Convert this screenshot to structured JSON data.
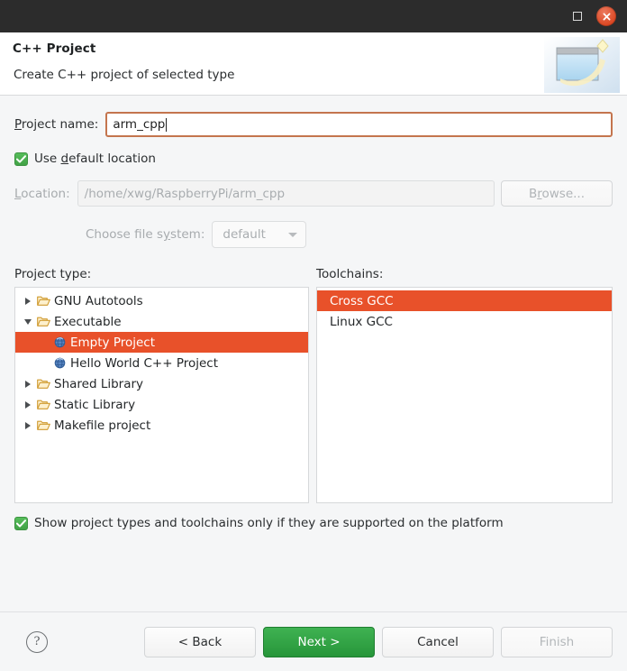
{
  "titlebar": {
    "maximize_label": "Maximize",
    "close_label": "Close"
  },
  "header": {
    "title": "C++ Project",
    "subtitle": "Create C++ project of selected type",
    "icon": "new-project-wizard-icon"
  },
  "form": {
    "project_name_label": "Project name:",
    "project_name_label_pre": "P",
    "project_name_label_post": "roject name:",
    "project_name_value": "arm_cpp",
    "use_default_location_label_pre": "Use ",
    "use_default_location_label_mid": "d",
    "use_default_location_label_post": "efault location",
    "use_default_location_checked": true,
    "location_label_pre": "L",
    "location_label_post": "ocation:",
    "location_value": "/home/xwg/RaspberryPi/arm_cpp",
    "location_disabled": true,
    "browse_label_pre": "B",
    "browse_label_mid": "r",
    "browse_label_post": "owse...",
    "browse_disabled": true,
    "filesystem_label_pre": "Choose file s",
    "filesystem_label_mid": "y",
    "filesystem_label_post": "stem:",
    "filesystem_value": "default",
    "filesystem_disabled": true
  },
  "project_type": {
    "label": "Project type:",
    "items": [
      {
        "label": "GNU Autotools",
        "depth": 0,
        "icon": "folder-icon",
        "twisty": "collapsed",
        "selected": false
      },
      {
        "label": "Executable",
        "depth": 0,
        "icon": "folder-icon",
        "twisty": "expanded",
        "selected": false
      },
      {
        "label": "Empty Project",
        "depth": 1,
        "icon": "sphere-icon",
        "twisty": "none",
        "selected": true
      },
      {
        "label": "Hello World C++ Project",
        "depth": 1,
        "icon": "sphere-icon",
        "twisty": "none",
        "selected": false
      },
      {
        "label": "Shared Library",
        "depth": 0,
        "icon": "folder-icon",
        "twisty": "collapsed",
        "selected": false
      },
      {
        "label": "Static Library",
        "depth": 0,
        "icon": "folder-icon",
        "twisty": "collapsed",
        "selected": false
      },
      {
        "label": "Makefile project",
        "depth": 0,
        "icon": "folder-icon",
        "twisty": "collapsed",
        "selected": false
      }
    ]
  },
  "toolchains": {
    "label": "Toolchains:",
    "items": [
      {
        "label": "Cross GCC",
        "selected": true
      },
      {
        "label": "Linux GCC",
        "selected": false
      }
    ]
  },
  "show_supported": {
    "label": "Show project types and toolchains only if they are supported on the platform",
    "checked": true
  },
  "footer": {
    "help_glyph": "?",
    "back_label": "< Back",
    "next_label": "Next >",
    "cancel_label": "Cancel",
    "finish_label": "Finish",
    "finish_disabled": true
  },
  "colors": {
    "selection": "#e8512a",
    "primary_button": "#2f9e41",
    "checkbox": "#4caf50",
    "focus_border": "#c4754e",
    "titlebar": "#2c2c2c"
  }
}
